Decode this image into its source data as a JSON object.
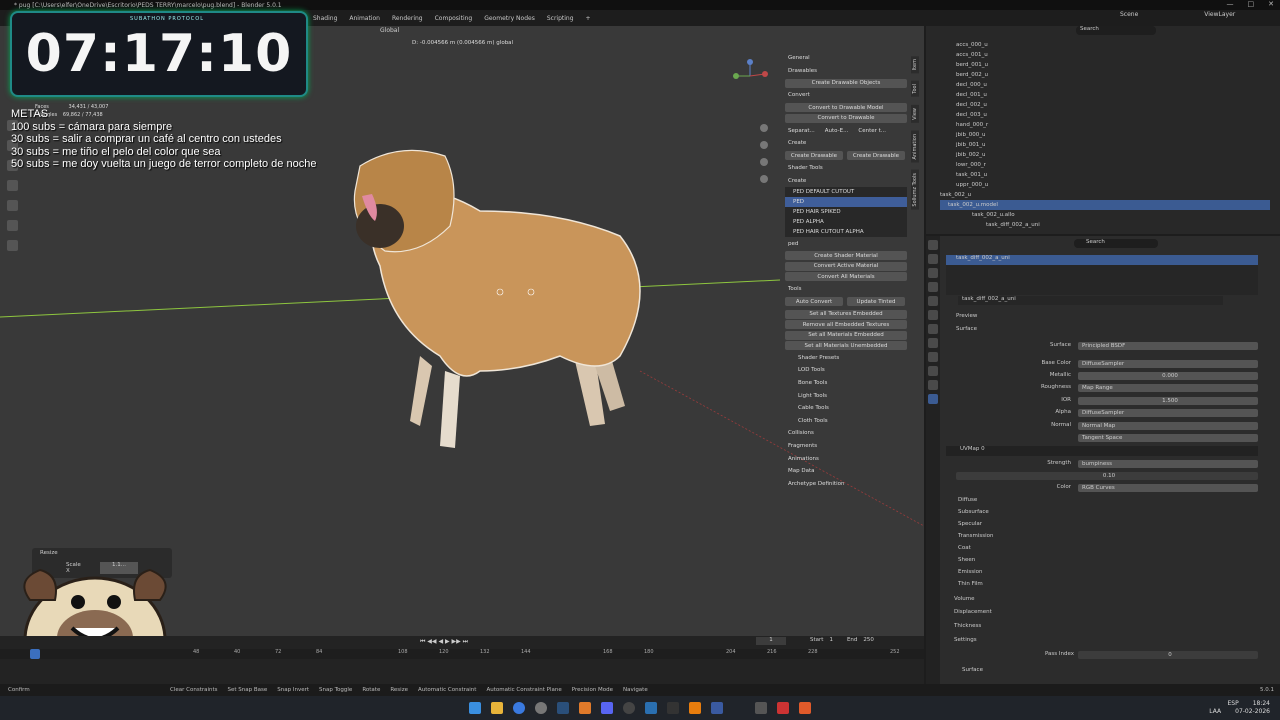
{
  "window": {
    "title": "* pug [C:\\Users\\elfer\\OneDrive\\Escritorio\\PEDS TERRY\\marcelo\\pug.blend] - Blender 5.0.1"
  },
  "workspaces": [
    "Shading",
    "Animation",
    "Rendering",
    "Compositing",
    "Geometry Nodes",
    "Scripting",
    "+"
  ],
  "topright": {
    "scene": "Scene",
    "viewlayer": "ViewLayer"
  },
  "viewport": {
    "orientation": "Global",
    "status": "D: -0.004566 m (0.004566 m) global"
  },
  "overlay": {
    "timer": "07:17:10",
    "timer_sub": "SUBATHON PROTOCOL",
    "metas_title": "METAS",
    "metas": [
      "100 subs = cámara para siempre",
      "30 subs = salir a comprar un café al centro con ustedes",
      "30 subs = me tiño el pelo del color que sea",
      "50 subs = me doy vuelta un juego de terror completo de noche"
    ]
  },
  "stats": {
    "faces_label": "Faces",
    "faces": "34,431 / 43,007",
    "tris_label": "Triangles",
    "tris": "69,862 / 77,438"
  },
  "npanel": {
    "general": "General",
    "drawables": "Drawables",
    "create_drawable_objects": "Create Drawable Objects",
    "convert": "Convert",
    "convert_to_drawable_model": "Convert to Drawable Model",
    "convert_to_drawable": "Convert to Drawable",
    "separate": "Separat...",
    "auto_e": "Auto-E...",
    "center": "Center t...",
    "create": "Create",
    "create_drawable": "Create Drawable",
    "create_drawable2": "Create Drawable",
    "shader_tools": "Shader Tools",
    "create2": "Create",
    "shaders": [
      "PED DEFAULT CUTOUT",
      "PED",
      "PED HAIR SPIKED",
      "PED ALPHA",
      "PED HAIR CUTOUT ALPHA"
    ],
    "filter": "ped",
    "create_shader_material": "Create Shader Material",
    "convert_active_material": "Convert Active Material",
    "convert_all_materials": "Convert All Materials",
    "tools": "Tools",
    "auto_convert": "Auto Convert",
    "update_tinted": "Update Tinted",
    "set_all_textures_embedded": "Set all Textures Embedded",
    "remove_all_embedded_textures": "Remove all Embedded Textures",
    "set_all_materials_embedded": "Set all Materials Embedded",
    "set_all_materials_unembedded": "Set all Materials Unembedded",
    "sub": [
      "Shader Presets",
      "LOD Tools",
      "Bone Tools",
      "Light Tools",
      "Cable Tools",
      "Cloth Tools"
    ],
    "sections": [
      "Collisions",
      "Fragments",
      "Animations",
      "Map Data",
      "Archetype Definition"
    ]
  },
  "vtabs": [
    "Item",
    "Tool",
    "View",
    "Animation",
    "Sollumz Tools"
  ],
  "resize": {
    "title": "Resize",
    "scale_label": "Scale X",
    "scale_value": "1.1..."
  },
  "outliner": {
    "search": "Search",
    "items": [
      "accs_000_u",
      "accs_001_u",
      "berd_001_u",
      "berd_002_u",
      "decl_000_u",
      "decl_001_u",
      "decl_002_u",
      "decl_003_u",
      "hand_000_r",
      "jbib_000_u",
      "jbib_001_u",
      "jbib_002_u",
      "lowr_000_r",
      "task_001_u",
      "uppr_000_u",
      "task_002_u",
      "task_002_u.model",
      "task_002_u.allo",
      "task_diff_002_a_uni"
    ]
  },
  "props": {
    "search": "Search",
    "material_slot": "task_diff_002_a_uni",
    "material_name": "task_diff_002_a_uni",
    "preview": "Preview",
    "surface_section": "Surface",
    "surface_label": "Surface",
    "surface_value": "Principled BSDF",
    "rows": [
      {
        "label": "Base Color",
        "value": "DiffuseSampler"
      },
      {
        "label": "Metallic",
        "value": "0.000"
      },
      {
        "label": "Roughness",
        "value": "Map Range"
      },
      {
        "label": "IOR",
        "value": "1.500"
      },
      {
        "label": "Alpha",
        "value": "DiffuseSampler"
      },
      {
        "label": "Normal",
        "value": "Normal Map"
      }
    ],
    "tangent": "Tangent Space",
    "uvmap": "UVMap 0",
    "strength_label": "Strength",
    "strength_value": "bumpiness",
    "strength_num": "0.10",
    "color_label": "Color",
    "color_value": "RGB Curves",
    "subsections": [
      "Diffuse",
      "Subsurface",
      "Specular",
      "Transmission",
      "Coat",
      "Sheen",
      "Emission",
      "Thin Film"
    ],
    "volume": "Volume",
    "displacement": "Displacement",
    "thickness": "Thickness",
    "settings": "Settings",
    "pass_index_label": "Pass Index",
    "pass_index_value": "0",
    "surface2": "Surface"
  },
  "timeline": {
    "frame": "1",
    "start_label": "Start",
    "start": "1",
    "end_label": "End",
    "end": "250",
    "ticks": [
      "48",
      "40",
      "72",
      "84",
      "108",
      "120",
      "132",
      "144",
      "168",
      "180",
      "204",
      "216",
      "228",
      "252"
    ]
  },
  "statusbar": [
    "Confirm",
    "Clear Constraints",
    "Set Snap Base",
    "Snap Invert",
    "Snap Toggle",
    "Rotate",
    "Resize",
    "Automatic Constraint",
    "Automatic Constraint Plane",
    "Precision Mode",
    "Navigate"
  ],
  "version": "5.0.1",
  "taskbar": {
    "lang": "ESP",
    "kbd": "LAA",
    "time": "18:24",
    "date": "07-02-2026"
  },
  "colors": {
    "accent": "#3b5b92",
    "model": "#c9955a",
    "grid_green": "#8ec63f"
  }
}
